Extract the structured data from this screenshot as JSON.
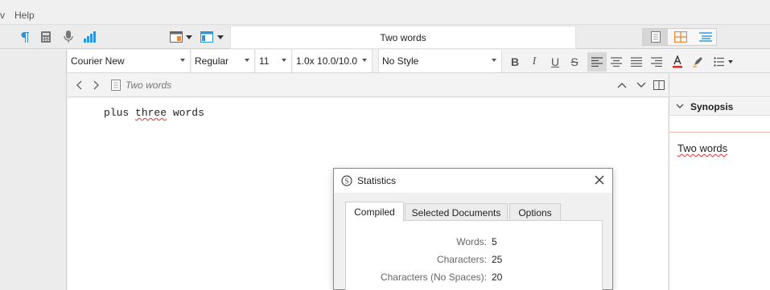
{
  "menubar": {
    "items": [
      "v",
      "Help"
    ]
  },
  "toolbar": {
    "title": "Two words",
    "icons": [
      "pilcrow-icon",
      "keyboard-icon",
      "microphone-icon",
      "bar-chart-icon",
      "layout-icon",
      "panel-icon"
    ],
    "view_modes": [
      "document-view-icon",
      "corkboard-view-icon",
      "outline-view-icon"
    ]
  },
  "formatbar": {
    "font": "Courier New",
    "weight": "Regular",
    "size": "11",
    "spacing": "1.0x 10.0/10.0",
    "style": "No Style",
    "buttons": [
      "B",
      "I",
      "U",
      "S"
    ]
  },
  "editor": {
    "header_title": "Two words",
    "content": {
      "word1": "plus",
      "word2": "three",
      "word3": "words"
    }
  },
  "inspector": {
    "synopsis_label": "Synopsis",
    "synopsis_text": "Two words"
  },
  "dialog": {
    "title": "Statistics",
    "tabs": [
      "Compiled",
      "Selected Documents",
      "Options"
    ],
    "active_tab": "Compiled",
    "stats": [
      {
        "label": "Words:",
        "value": "5"
      },
      {
        "label": "Characters:",
        "value": "25"
      },
      {
        "label": "Characters (No Spaces):",
        "value": "20"
      }
    ]
  },
  "colors": {
    "accent_orange": "#e8893a",
    "accent_blue": "#2f95d8",
    "spell_red": "#d33333"
  }
}
